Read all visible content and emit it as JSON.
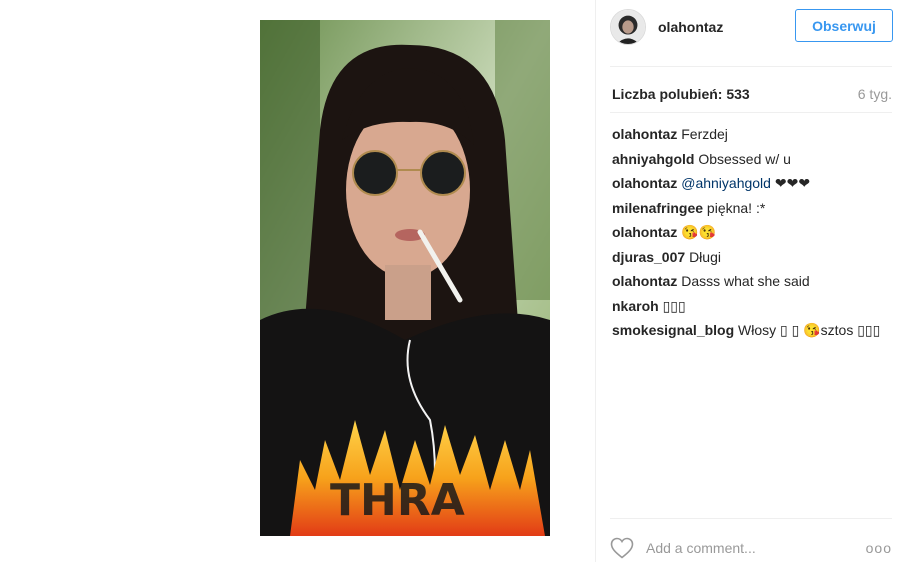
{
  "post": {
    "username": "olahontaz",
    "follow_label": "Obserwuj",
    "likes_text": "Liczba polubień: 533",
    "time_ago": "6 tyg."
  },
  "comments": [
    {
      "user": "olahontaz",
      "text": "Ferzdej"
    },
    {
      "user": "ahniyahgold",
      "text": "Obsessed w/ u"
    },
    {
      "user": "olahontaz",
      "mention": "@ahniyahgold",
      "text": " ❤❤❤"
    },
    {
      "user": "milenafringee",
      "text": "piękna! :*"
    },
    {
      "user": "olahontaz",
      "text": "😘😘"
    },
    {
      "user": "djuras_007",
      "text": "Długi"
    },
    {
      "user": "olahontaz",
      "text": "Dasss what she said"
    },
    {
      "user": "nkaroh",
      "text": "▯▯▯"
    },
    {
      "user": "smokesignal_blog",
      "text": "Włosy ▯ ▯ 😘sztos ▯▯▯"
    }
  ],
  "footer": {
    "comment_placeholder": "Add a comment...",
    "more_glyph": "ooo"
  },
  "icons": {
    "heart": "heart-icon",
    "more": "more-options-icon",
    "avatar": "avatar"
  },
  "colors": {
    "accent": "#3897f0",
    "mention": "#003569",
    "muted": "#999999"
  }
}
